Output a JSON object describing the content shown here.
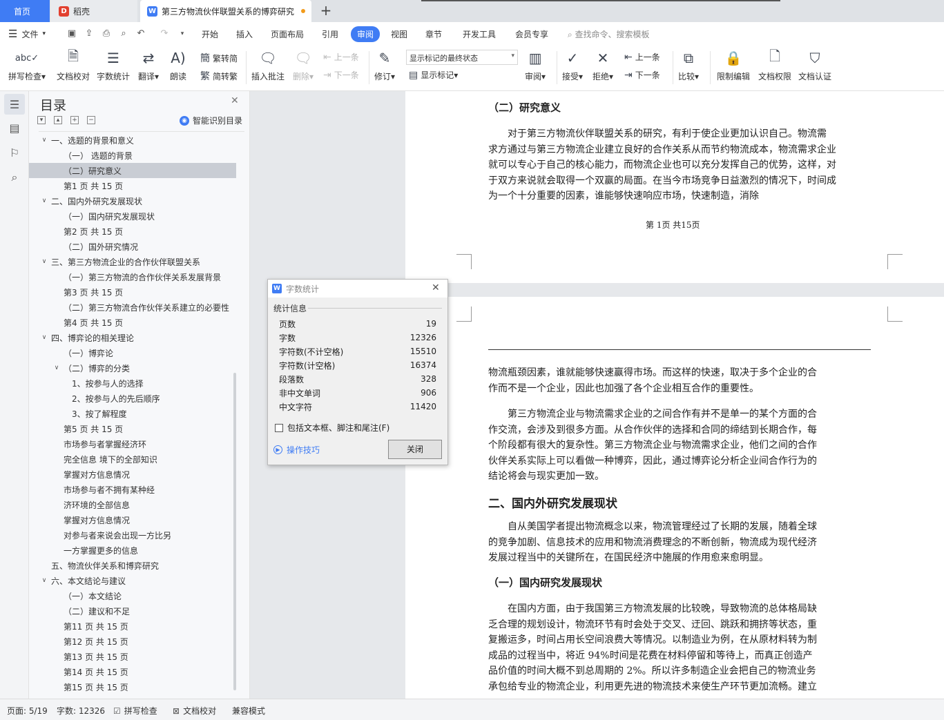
{
  "tabs": {
    "home": "首页",
    "daoke": "稻壳",
    "doc": "第三方物流伙伴联盟关系的博弈研究",
    "add": "+"
  },
  "menu": {
    "file": "文件",
    "tabs": [
      "开始",
      "插入",
      "页面布局",
      "引用",
      "审阅",
      "视图",
      "章节",
      "开发工具",
      "会员专享"
    ],
    "active_tab": "审阅",
    "search_placeholder": "查找命令、搜索模板"
  },
  "ribbon": {
    "spellcheck": "拼写检查",
    "doccheck": "文档校对",
    "wordcount": "字数统计",
    "translate": "翻译",
    "read": "朗读",
    "trad_simp": "繁转简",
    "simp_trad": "简转繁",
    "insert_comment": "插入批注",
    "delete": "删除",
    "prev_comment": "上一条",
    "next_comment": "下一条",
    "revise": "修订",
    "markup_state": "显示标记的最终状态",
    "show_markup": "显示标记",
    "review": "审阅",
    "accept": "接受",
    "reject": "拒绝",
    "prev_change": "上一条",
    "next_change": "下一条",
    "compare": "比较",
    "restrict_edit": "限制编辑",
    "doc_permission": "文档权限",
    "doc_auth": "文档认证"
  },
  "toc": {
    "title": "目录",
    "smart": "智能识别目录",
    "items": [
      {
        "text": "一、选题的背景和意义",
        "level": 0,
        "caret": "expanded"
      },
      {
        "text": "（一） 选题的背景",
        "level": 1
      },
      {
        "text": "（二）研究意义",
        "level": 1,
        "selected": true
      },
      {
        "text": "第1 页 共 15 页",
        "level": 1
      },
      {
        "text": "二、国内外研究发展现状",
        "level": 0,
        "caret": "expanded"
      },
      {
        "text": "（一）国内研究发展现状",
        "level": 1
      },
      {
        "text": "第2 页 共 15 页",
        "level": 1
      },
      {
        "text": "（二）国外研究情况",
        "level": 1
      },
      {
        "text": "三、第三方物流企业的合作伙伴联盟关系",
        "level": 0,
        "caret": "expanded"
      },
      {
        "text": "（一）第三方物流的合作伙伴关系发展背景",
        "level": 1
      },
      {
        "text": "第3 页 共 15 页",
        "level": 1
      },
      {
        "text": "（二）第三方物流合作伙伴关系建立的必要性",
        "level": 1
      },
      {
        "text": "第4 页 共 15 页",
        "level": 1
      },
      {
        "text": "四、博弈论的相关理论",
        "level": 0,
        "caret": "expanded"
      },
      {
        "text": "（一）博弈论",
        "level": 1
      },
      {
        "text": "（二）博弈的分类",
        "level": 1,
        "caret": "expanded"
      },
      {
        "text": "1、按参与人的选择",
        "level": 2
      },
      {
        "text": "2、按参与人的先后顺序",
        "level": 2
      },
      {
        "text": "3、按了解程度",
        "level": 2
      },
      {
        "text": "第5 页 共 15 页",
        "level": 1
      },
      {
        "text": "市场参与者掌握经济环",
        "level": 1
      },
      {
        "text": "完全信息 境下的全部知识",
        "level": 1
      },
      {
        "text": "掌握对方信息情况",
        "level": 1
      },
      {
        "text": "市场参与者不拥有某种经",
        "level": 1
      },
      {
        "text": "济环境的全部信息",
        "level": 1
      },
      {
        "text": "掌握对方信息情况",
        "level": 1
      },
      {
        "text": "对参与者来说会出现一方比另",
        "level": 1
      },
      {
        "text": "一方掌握更多的信息",
        "level": 1
      },
      {
        "text": "五、物流伙伴关系和博弈研究",
        "level": 0
      },
      {
        "text": "六、本文结论与建议",
        "level": 0,
        "caret": "expanded"
      },
      {
        "text": "（一）本文结论",
        "level": 1
      },
      {
        "text": "（二）建议和不足",
        "level": 1
      },
      {
        "text": "第11 页 共 15 页",
        "level": 1
      },
      {
        "text": "第12 页 共 15 页",
        "level": 1
      },
      {
        "text": "第13 页 共 15 页",
        "level": 1
      },
      {
        "text": "第14 页 共 15 页",
        "level": 1
      },
      {
        "text": "第15 页 共 15 页",
        "level": 1
      }
    ]
  },
  "doc": {
    "p1_heading": "（二）研究意义",
    "p1_lines": [
      "　　对于第三方物流伙伴联盟关系的研究，有利于使企业更加认识自己。物流需",
      "求方通过与第三方物流企业建立良好的合作关系从而节约物流成本，物流需求企业",
      "就可以专心于自己的核心能力，而物流企业也可以充分发挥自己的优势，这样，对",
      "于双方来说就会取得一个双赢的局面。在当今市场竞争日益激烈的情况下，时间成",
      "为一个十分重要的因素，谁能够快速响应市场，快速制造，消除"
    ],
    "p1_footer": "第 1页 共15页",
    "p2a_lines": [
      "物流瓶颈因素，谁就能够快速赢得市场。而这样的快速，取决于多个企业的合",
      "作而不是一个企业，因此也加强了各个企业相互合作的重要性。"
    ],
    "p2b_lines": [
      "　　第三方物流企业与物流需求企业的之间合作有并不是单一的某个方面的合",
      "作交流，会涉及到很多方面。从合作伙伴的选择和合同的缔结到长期合作，每",
      "个阶段都有很大的复杂性。第三方物流企业与物流需求企业，他们之间的合作",
      "伙伴关系实际上可以看做一种博弈，因此，通过博弈论分析企业间合作行为的",
      "结论将会与现实更加一致。"
    ],
    "h_section2": "二、国内外研究发展现状",
    "p2c_lines": [
      "　　自从美国学者提出物流概念以来，物流管理经过了长期的发展，随着全球",
      "的竞争加剧、信息技术的应用和物流消费理念的不断创新，物流成为现代经济",
      "发展过程当中的关键所在，在国民经济中施展的作用愈来愈明显。"
    ],
    "h_sub1": "（一）国内研究发展现状",
    "p2d_lines": [
      "　　在国内方面，由于我国第三方物流发展的比较晚，导致物流的总体格局缺",
      "乏合理的规划设计，物流环节有时会处于交叉、迂回、跳跃和拥挤等状态，重",
      "复搬运多，时间占用长空间浪费大等情况。以制造业为例，在从原材料转为制",
      "成品的过程当中，将近 94%时间是花费在材料停留和等待上，而真正创造产",
      "品价值的时间大概不到总周期的 2%。所以许多制造企业会把自己的物流业务",
      "承包给专业的物流企业，利用更先进的物流技术来使生产环节更加流畅。建立"
    ]
  },
  "dialog": {
    "title": "字数统计",
    "section": "统计信息",
    "stats": [
      {
        "label": "页数",
        "value": "19"
      },
      {
        "label": "字数",
        "value": "12326"
      },
      {
        "label": "字符数(不计空格)",
        "value": "15510"
      },
      {
        "label": "字符数(计空格)",
        "value": "16374"
      },
      {
        "label": "段落数",
        "value": "328"
      },
      {
        "label": "非中文单词",
        "value": "906"
      },
      {
        "label": "中文字符",
        "value": "11420"
      }
    ],
    "include_label": "包括文本框、脚注和尾注(F)",
    "tips": "操作技巧",
    "close_btn": "关闭"
  },
  "status": {
    "page": "页面: 5/19",
    "words": "字数: 12326",
    "spell": "拼写检查",
    "doccheck": "文档校对",
    "compat": "兼容模式"
  },
  "colors": {
    "accent": "#3f7cf4",
    "unsaved_dot": "#f29b1b",
    "daoke_logo": "#e2402f"
  }
}
